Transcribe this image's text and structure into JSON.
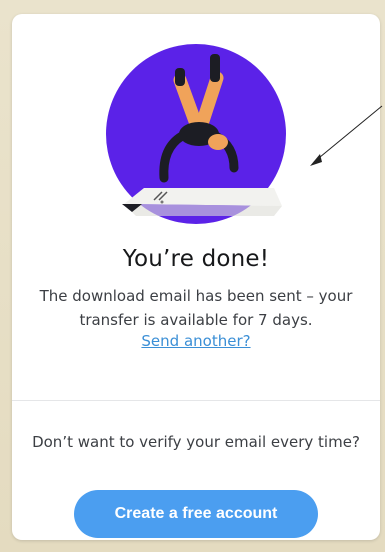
{
  "result": {
    "title": "You’re done!",
    "description": "The download email has been sent – your transfer is available for 7 days.",
    "link_label": "Send another?"
  },
  "signup": {
    "question": "Don’t want to verify your email every time?",
    "cta_label": "Create a free account"
  },
  "colors": {
    "accent": "#4b9ef0",
    "link": "#3b8fd6",
    "illustration_circle": "#5b22e8",
    "figure_orange": "#f0a35a",
    "figure_dark": "#1c1d24"
  }
}
